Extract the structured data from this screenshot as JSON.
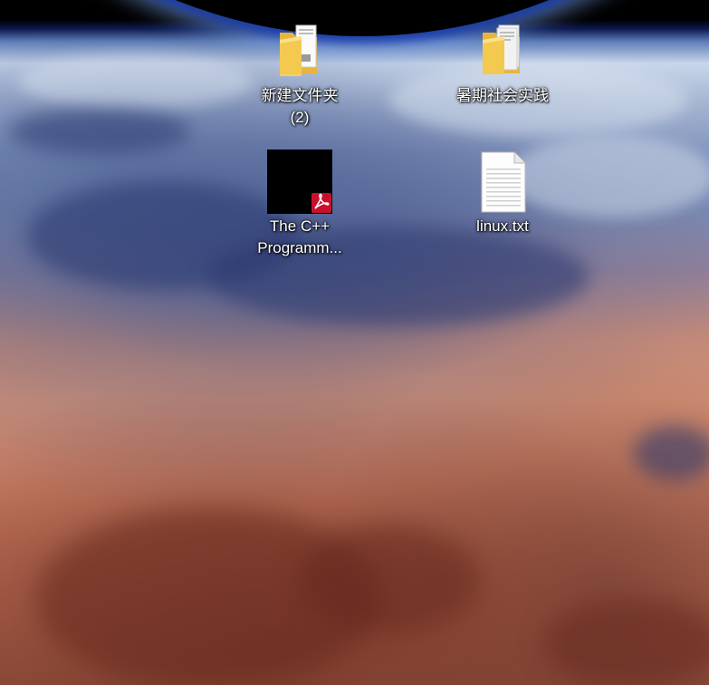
{
  "desktop": {
    "wallpaper": "earth-from-orbit",
    "icons": [
      {
        "label": "新建文件夹\n(2)",
        "icon": "folder-icon"
      },
      {
        "label": "暑期社会实践",
        "icon": "folder-icon"
      },
      {
        "label": "The C++\nProgramm...",
        "icon": "pdf-file-icon"
      },
      {
        "label": "linux.txt",
        "icon": "text-file-icon"
      }
    ]
  },
  "colors": {
    "folder": "#f3c94f",
    "pdf_badge": "#c8102e",
    "thumbnail": "#000000",
    "label_text": "#ffffff"
  }
}
